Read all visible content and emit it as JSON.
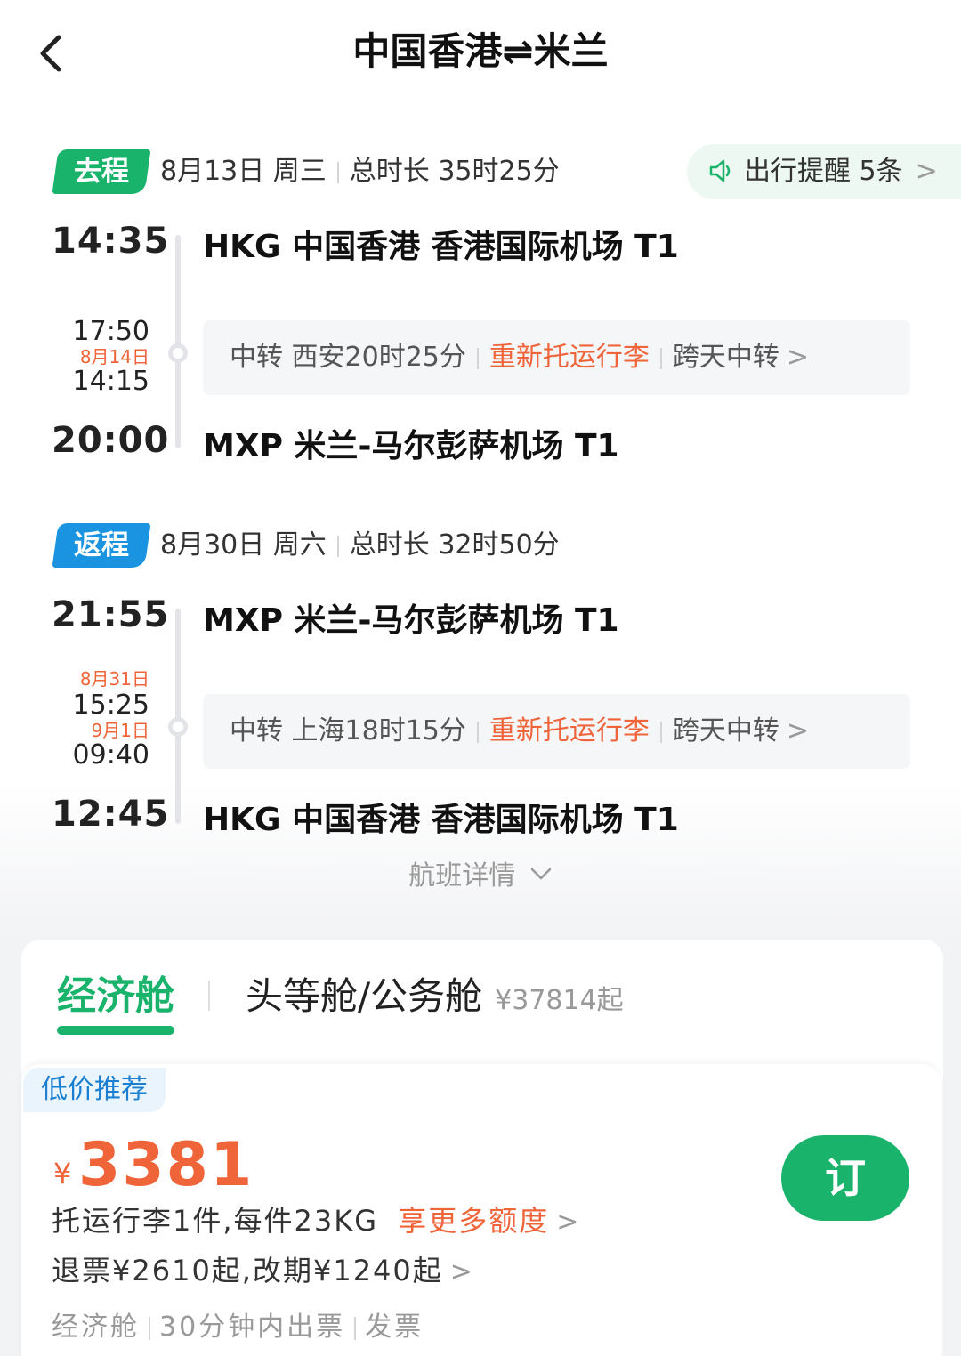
{
  "header": {
    "title": "中国香港⇌米兰"
  },
  "reminder": {
    "label": "出行提醒 5条"
  },
  "outbound": {
    "tag": "去程",
    "date": "8月13日 周三",
    "duration": "总时长 35时25分",
    "depart_time": "14:35",
    "depart_airport": "HKG 中国香港 香港国际机场 T1",
    "transfer_arrive_time": "17:50",
    "transfer_next_date": "8月14日",
    "transfer_depart_time": "14:15",
    "transfer_text": "中转 西安20时25分",
    "recheck_text": "重新托运行李",
    "overnight_text": "跨天中转",
    "arrive_time": "20:00",
    "arrive_airport": "MXP 米兰-马尔彭萨机场 T1"
  },
  "return": {
    "tag": "返程",
    "date": "8月30日 周六",
    "duration": "总时长 32时50分",
    "depart_time": "21:55",
    "depart_airport": "MXP 米兰-马尔彭萨机场 T1",
    "transfer_arrive_date": "8月31日",
    "transfer_arrive_time": "15:25",
    "transfer_next_date": "9月1日",
    "transfer_depart_time": "09:40",
    "transfer_text": "中转 上海18时15分",
    "recheck_text": "重新托运行李",
    "overnight_text": "跨天中转",
    "arrive_time": "12:45",
    "arrive_airport": "HKG 中国香港 香港国际机场 T1"
  },
  "flight_details_label": "航班详情",
  "cabin_tabs": {
    "economy": "经济舱",
    "first_business": "头等舱/公务舱",
    "first_business_price": "¥37814起"
  },
  "offer": {
    "badge": "低价推荐",
    "currency": "¥",
    "price": "3381",
    "book_label": "订",
    "baggage_text": "托运行李1件,每件23KG",
    "baggage_more": "享更多额度",
    "refund_text": "退票¥2610起,改期¥1240起",
    "footer_cabin": "经济舱",
    "footer_ticketing": "30分钟内出票",
    "footer_invoice": "发票"
  },
  "colors": {
    "green": "#19b36b",
    "blue": "#1a94e0",
    "orange": "#f0643a"
  }
}
